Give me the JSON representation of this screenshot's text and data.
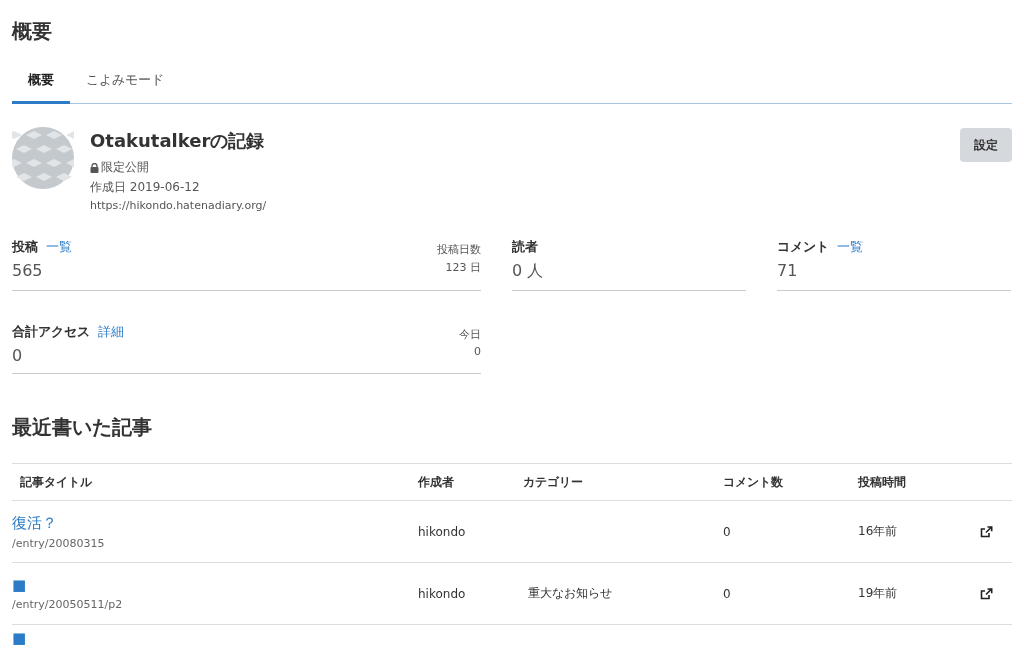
{
  "page_title": "概要",
  "tabs": [
    {
      "label": "概要",
      "selected": true
    },
    {
      "label": "こよみモード",
      "selected": false
    }
  ],
  "blog": {
    "name": "Otakutalkerの記録",
    "visibility": "限定公開",
    "created": "作成日 2019-06-12",
    "url": "https://hikondo.hatenadiary.org/"
  },
  "settings_button": "設定",
  "stats": [
    {
      "label": "投稿",
      "link": "一覧",
      "value": "565",
      "side_label": "投稿日数",
      "side_value": "123 日"
    },
    {
      "label": "読者",
      "value": "0 人"
    },
    {
      "label": "コメント",
      "link": "一覧",
      "value": "71"
    },
    {
      "label": "合計アクセス",
      "link": "詳細",
      "value": "0",
      "side_label": "今日",
      "side_value": "0"
    }
  ],
  "recent": {
    "heading": "最近書いた記事",
    "columns": [
      "記事タイトル",
      "作成者",
      "カテゴリー",
      "コメント数",
      "投稿時間"
    ],
    "rows": [
      {
        "title": "復活？",
        "path": "/entry/20080315",
        "author": "hikondo",
        "comments": "0",
        "time": "16年前"
      },
      {
        "title": "■",
        "path": "/entry/20050511/p2",
        "author": "hikondo",
        "category": "重大なお知らせ",
        "comments": "0",
        "time": "19年前"
      },
      {
        "title": "■"
      }
    ]
  }
}
